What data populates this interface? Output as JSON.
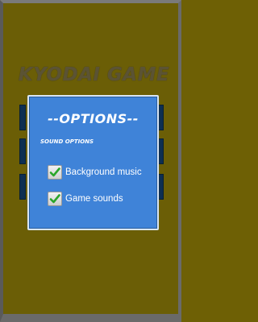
{
  "game": {
    "title": "KYODAI GAME"
  },
  "options_dialog": {
    "title": "--OPTIONS--",
    "section_label": "SOUND OPTIONS",
    "options": [
      {
        "label": "Background music",
        "checked": true,
        "icon": "checkmark-icon"
      },
      {
        "label": "Game sounds",
        "checked": true,
        "icon": "checkmark-icon"
      }
    ]
  },
  "colors": {
    "background": "#6b5e06",
    "dialog": "#3f83d8",
    "check": "#2aa62a"
  }
}
